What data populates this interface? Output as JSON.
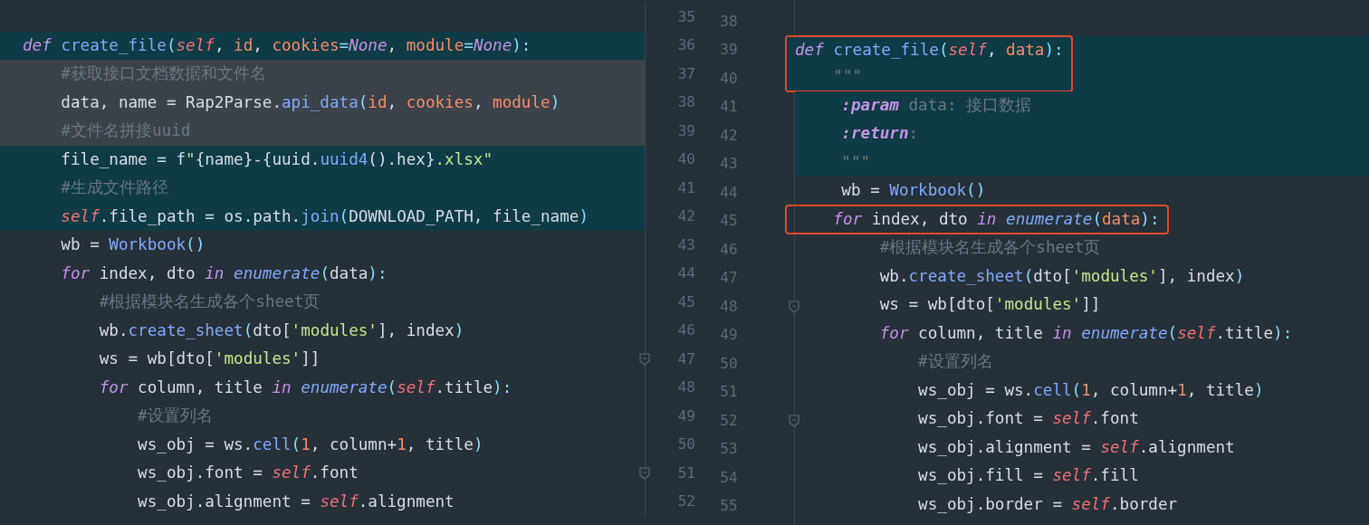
{
  "left_pane": {
    "lines": [
      {
        "number": "35",
        "changed": false,
        "selected": false,
        "fold": false
      },
      {
        "number": "36",
        "changed": true,
        "selected": false,
        "fold": false,
        "tokens": [
          {
            "kind": "keyword",
            "text": "def "
          },
          {
            "kind": "function",
            "text": "create_file"
          },
          {
            "kind": "punct",
            "text": "("
          },
          {
            "kind": "self",
            "text": "self"
          },
          {
            "kind": "plain",
            "text": ", "
          },
          {
            "kind": "param",
            "text": "id"
          },
          {
            "kind": "plain",
            "text": ", "
          },
          {
            "kind": "param",
            "text": "cookies"
          },
          {
            "kind": "punct",
            "text": "="
          },
          {
            "kind": "constant",
            "text": "None"
          },
          {
            "kind": "plain",
            "text": ", "
          },
          {
            "kind": "param",
            "text": "module"
          },
          {
            "kind": "punct",
            "text": "="
          },
          {
            "kind": "constant",
            "text": "None"
          },
          {
            "kind": "punct",
            "text": "):"
          }
        ]
      },
      {
        "number": "37",
        "changed": true,
        "selected": true,
        "fold": false,
        "tokens": [
          {
            "kind": "comment",
            "text": "    #获取接口文档数据和文件名"
          }
        ]
      },
      {
        "number": "38",
        "changed": true,
        "selected": true,
        "fold": false,
        "tokens": [
          {
            "kind": "plain",
            "text": "    data, name = Rap2Parse."
          },
          {
            "kind": "function",
            "text": "api_data"
          },
          {
            "kind": "punct",
            "text": "("
          },
          {
            "kind": "param",
            "text": "id"
          },
          {
            "kind": "plain",
            "text": ", "
          },
          {
            "kind": "param",
            "text": "cookies"
          },
          {
            "kind": "plain",
            "text": ", "
          },
          {
            "kind": "param",
            "text": "module"
          },
          {
            "kind": "punct",
            "text": ")"
          }
        ]
      },
      {
        "number": "39",
        "changed": true,
        "selected": true,
        "fold": false,
        "tokens": [
          {
            "kind": "comment",
            "text": "    #文件名拼接uuid"
          }
        ]
      },
      {
        "number": "40",
        "changed": true,
        "selected": false,
        "fold": false,
        "tokens": [
          {
            "kind": "plain",
            "text": "    file_name = f"
          },
          {
            "kind": "string",
            "text": "\""
          },
          {
            "kind": "plain",
            "text": "{name}-{uuid."
          },
          {
            "kind": "function",
            "text": "uuid4"
          },
          {
            "kind": "plain",
            "text": "().hex}"
          },
          {
            "kind": "string",
            "text": ".xlsx\""
          }
        ]
      },
      {
        "number": "41",
        "changed": true,
        "selected": false,
        "fold": false,
        "tokens": [
          {
            "kind": "comment",
            "text": "    #生成文件路径"
          }
        ]
      },
      {
        "number": "42",
        "changed": true,
        "selected": false,
        "fold": false,
        "tokens": [
          {
            "kind": "self",
            "text": "    self"
          },
          {
            "kind": "plain",
            "text": ".file_path = os.path."
          },
          {
            "kind": "function",
            "text": "join"
          },
          {
            "kind": "punct",
            "text": "("
          },
          {
            "kind": "plain",
            "text": "DOWNLOAD_PATH, file_name"
          },
          {
            "kind": "punct",
            "text": ")"
          }
        ]
      },
      {
        "number": "43",
        "changed": false,
        "selected": false,
        "fold": false,
        "tokens": [
          {
            "kind": "plain",
            "text": "    wb = "
          },
          {
            "kind": "function",
            "text": "Workbook"
          },
          {
            "kind": "punct",
            "text": "()"
          }
        ]
      },
      {
        "number": "44",
        "changed": false,
        "selected": false,
        "fold": false,
        "tokens": [
          {
            "kind": "keyword",
            "text": "    for"
          },
          {
            "kind": "plain",
            "text": " index, dto "
          },
          {
            "kind": "keyword",
            "text": "in "
          },
          {
            "kind": "builtin",
            "text": "enumerate"
          },
          {
            "kind": "punct",
            "text": "("
          },
          {
            "kind": "plain",
            "text": "data"
          },
          {
            "kind": "punct",
            "text": "):"
          }
        ]
      },
      {
        "number": "45",
        "changed": false,
        "selected": false,
        "fold": false,
        "tokens": [
          {
            "kind": "comment",
            "text": "        #根据模块名生成各个sheet页"
          }
        ]
      },
      {
        "number": "46",
        "changed": false,
        "selected": false,
        "fold": false,
        "tokens": [
          {
            "kind": "plain",
            "text": "        wb."
          },
          {
            "kind": "function",
            "text": "create_sheet"
          },
          {
            "kind": "punct",
            "text": "("
          },
          {
            "kind": "plain",
            "text": "dto["
          },
          {
            "kind": "string",
            "text": "'modules'"
          },
          {
            "kind": "plain",
            "text": "], index"
          },
          {
            "kind": "punct",
            "text": ")"
          }
        ]
      },
      {
        "number": "47",
        "changed": false,
        "selected": false,
        "fold": true,
        "tokens": [
          {
            "kind": "plain",
            "text": "        ws = wb[dto["
          },
          {
            "kind": "string",
            "text": "'modules'"
          },
          {
            "kind": "plain",
            "text": "]]"
          }
        ]
      },
      {
        "number": "48",
        "changed": false,
        "selected": false,
        "fold": false,
        "tokens": [
          {
            "kind": "keyword",
            "text": "        for"
          },
          {
            "kind": "plain",
            "text": " column, title "
          },
          {
            "kind": "keyword",
            "text": "in "
          },
          {
            "kind": "builtin",
            "text": "enumerate"
          },
          {
            "kind": "punct",
            "text": "("
          },
          {
            "kind": "self",
            "text": "self"
          },
          {
            "kind": "plain",
            "text": ".title"
          },
          {
            "kind": "punct",
            "text": "):"
          }
        ]
      },
      {
        "number": "49",
        "changed": false,
        "selected": false,
        "fold": false,
        "tokens": [
          {
            "kind": "comment",
            "text": "            #设置列名"
          }
        ]
      },
      {
        "number": "50",
        "changed": false,
        "selected": false,
        "fold": false,
        "tokens": [
          {
            "kind": "plain",
            "text": "            ws_obj = ws."
          },
          {
            "kind": "function",
            "text": "cell"
          },
          {
            "kind": "punct",
            "text": "("
          },
          {
            "kind": "number",
            "text": "1"
          },
          {
            "kind": "plain",
            "text": ", column+"
          },
          {
            "kind": "number",
            "text": "1"
          },
          {
            "kind": "plain",
            "text": ", title"
          },
          {
            "kind": "punct",
            "text": ")"
          }
        ]
      },
      {
        "number": "51",
        "changed": false,
        "selected": false,
        "fold": true,
        "tokens": [
          {
            "kind": "plain",
            "text": "            ws_obj.font = "
          },
          {
            "kind": "self",
            "text": "self"
          },
          {
            "kind": "plain",
            "text": ".font"
          }
        ]
      },
      {
        "number": "52",
        "changed": false,
        "selected": false,
        "fold": false,
        "tokens": [
          {
            "kind": "plain",
            "text": "            ws_obj.alignment = "
          },
          {
            "kind": "self",
            "text": "self"
          },
          {
            "kind": "plain",
            "text": ".alignment"
          }
        ]
      }
    ]
  },
  "right_pane": {
    "lines": [
      {
        "number": "38",
        "changed": false,
        "boxed": false,
        "fold": false
      },
      {
        "number": "39",
        "changed": true,
        "boxed": true,
        "fold": false,
        "tokens": [
          {
            "kind": "keyword",
            "text": "def "
          },
          {
            "kind": "function",
            "text": "create_file"
          },
          {
            "kind": "punct",
            "text": "("
          },
          {
            "kind": "self",
            "text": "self"
          },
          {
            "kind": "plain",
            "text": ", "
          },
          {
            "kind": "param",
            "text": "data"
          },
          {
            "kind": "punct",
            "text": "):"
          }
        ]
      },
      {
        "number": "40",
        "changed": true,
        "boxed": true,
        "fold": false,
        "tokens": [
          {
            "kind": "comment",
            "text": "    \"\"\""
          }
        ]
      },
      {
        "number": "41",
        "changed": true,
        "boxed": false,
        "fold": false,
        "tokens": [
          {
            "kind": "doc_tag",
            "text": "    :param"
          },
          {
            "kind": "comment",
            "text": " data: 接口数据"
          }
        ]
      },
      {
        "number": "42",
        "changed": true,
        "boxed": false,
        "fold": false,
        "tokens": [
          {
            "kind": "doc_tag",
            "text": "    :return"
          },
          {
            "kind": "comment",
            "text": ":"
          }
        ]
      },
      {
        "number": "43",
        "changed": true,
        "boxed": false,
        "fold": false,
        "tokens": [
          {
            "kind": "comment",
            "text": "    \"\"\""
          }
        ]
      },
      {
        "number": "44",
        "changed": false,
        "boxed": false,
        "fold": false,
        "tokens": [
          {
            "kind": "plain",
            "text": "    wb = "
          },
          {
            "kind": "function",
            "text": "Workbook"
          },
          {
            "kind": "punct",
            "text": "()"
          }
        ]
      },
      {
        "number": "45",
        "changed": false,
        "boxed": true,
        "fold": false,
        "tokens": [
          {
            "kind": "keyword",
            "text": "    for"
          },
          {
            "kind": "plain",
            "text": " index, dto "
          },
          {
            "kind": "keyword",
            "text": "in "
          },
          {
            "kind": "builtin",
            "text": "enumerate"
          },
          {
            "kind": "punct",
            "text": "("
          },
          {
            "kind": "param",
            "text": "data"
          },
          {
            "kind": "punct",
            "text": "):"
          }
        ]
      },
      {
        "number": "46",
        "changed": false,
        "boxed": false,
        "fold": false,
        "tokens": [
          {
            "kind": "comment",
            "text": "        #根据模块名生成各个sheet页"
          }
        ]
      },
      {
        "number": "47",
        "changed": false,
        "boxed": false,
        "fold": false,
        "tokens": [
          {
            "kind": "plain",
            "text": "        wb."
          },
          {
            "kind": "function",
            "text": "create_sheet"
          },
          {
            "kind": "punct",
            "text": "("
          },
          {
            "kind": "plain",
            "text": "dto["
          },
          {
            "kind": "string",
            "text": "'modules'"
          },
          {
            "kind": "plain",
            "text": "], index"
          },
          {
            "kind": "punct",
            "text": ")"
          }
        ]
      },
      {
        "number": "48",
        "changed": false,
        "boxed": false,
        "fold": true,
        "tokens": [
          {
            "kind": "plain",
            "text": "        ws = wb[dto["
          },
          {
            "kind": "string",
            "text": "'modules'"
          },
          {
            "kind": "plain",
            "text": "]]"
          }
        ]
      },
      {
        "number": "49",
        "changed": false,
        "boxed": false,
        "fold": false,
        "tokens": [
          {
            "kind": "keyword",
            "text": "        for"
          },
          {
            "kind": "plain",
            "text": " column, title "
          },
          {
            "kind": "keyword",
            "text": "in "
          },
          {
            "kind": "builtin",
            "text": "enumerate"
          },
          {
            "kind": "punct",
            "text": "("
          },
          {
            "kind": "self",
            "text": "self"
          },
          {
            "kind": "plain",
            "text": ".title"
          },
          {
            "kind": "punct",
            "text": "):"
          }
        ]
      },
      {
        "number": "50",
        "changed": false,
        "boxed": false,
        "fold": false,
        "tokens": [
          {
            "kind": "comment",
            "text": "            #设置列名"
          }
        ]
      },
      {
        "number": "51",
        "changed": false,
        "boxed": false,
        "fold": false,
        "tokens": [
          {
            "kind": "plain",
            "text": "            ws_obj = ws."
          },
          {
            "kind": "function",
            "text": "cell"
          },
          {
            "kind": "punct",
            "text": "("
          },
          {
            "kind": "number",
            "text": "1"
          },
          {
            "kind": "plain",
            "text": ", column+"
          },
          {
            "kind": "number",
            "text": "1"
          },
          {
            "kind": "plain",
            "text": ", title"
          },
          {
            "kind": "punct",
            "text": ")"
          }
        ]
      },
      {
        "number": "52",
        "changed": false,
        "boxed": false,
        "fold": true,
        "tokens": [
          {
            "kind": "plain",
            "text": "            ws_obj.font = "
          },
          {
            "kind": "self",
            "text": "self"
          },
          {
            "kind": "plain",
            "text": ".font"
          }
        ]
      },
      {
        "number": "53",
        "changed": false,
        "boxed": false,
        "fold": false,
        "tokens": [
          {
            "kind": "plain",
            "text": "            ws_obj.alignment = "
          },
          {
            "kind": "self",
            "text": "self"
          },
          {
            "kind": "plain",
            "text": ".alignment"
          }
        ]
      },
      {
        "number": "54",
        "changed": false,
        "boxed": false,
        "fold": false,
        "tokens": [
          {
            "kind": "plain",
            "text": "            ws_obj.fill = "
          },
          {
            "kind": "self",
            "text": "self"
          },
          {
            "kind": "plain",
            "text": ".fill"
          }
        ]
      },
      {
        "number": "55",
        "changed": false,
        "boxed": false,
        "fold": false,
        "tokens": [
          {
            "kind": "plain",
            "text": "            ws_obj.border = "
          },
          {
            "kind": "self",
            "text": "self"
          },
          {
            "kind": "plain",
            "text": ".border"
          }
        ]
      }
    ]
  }
}
